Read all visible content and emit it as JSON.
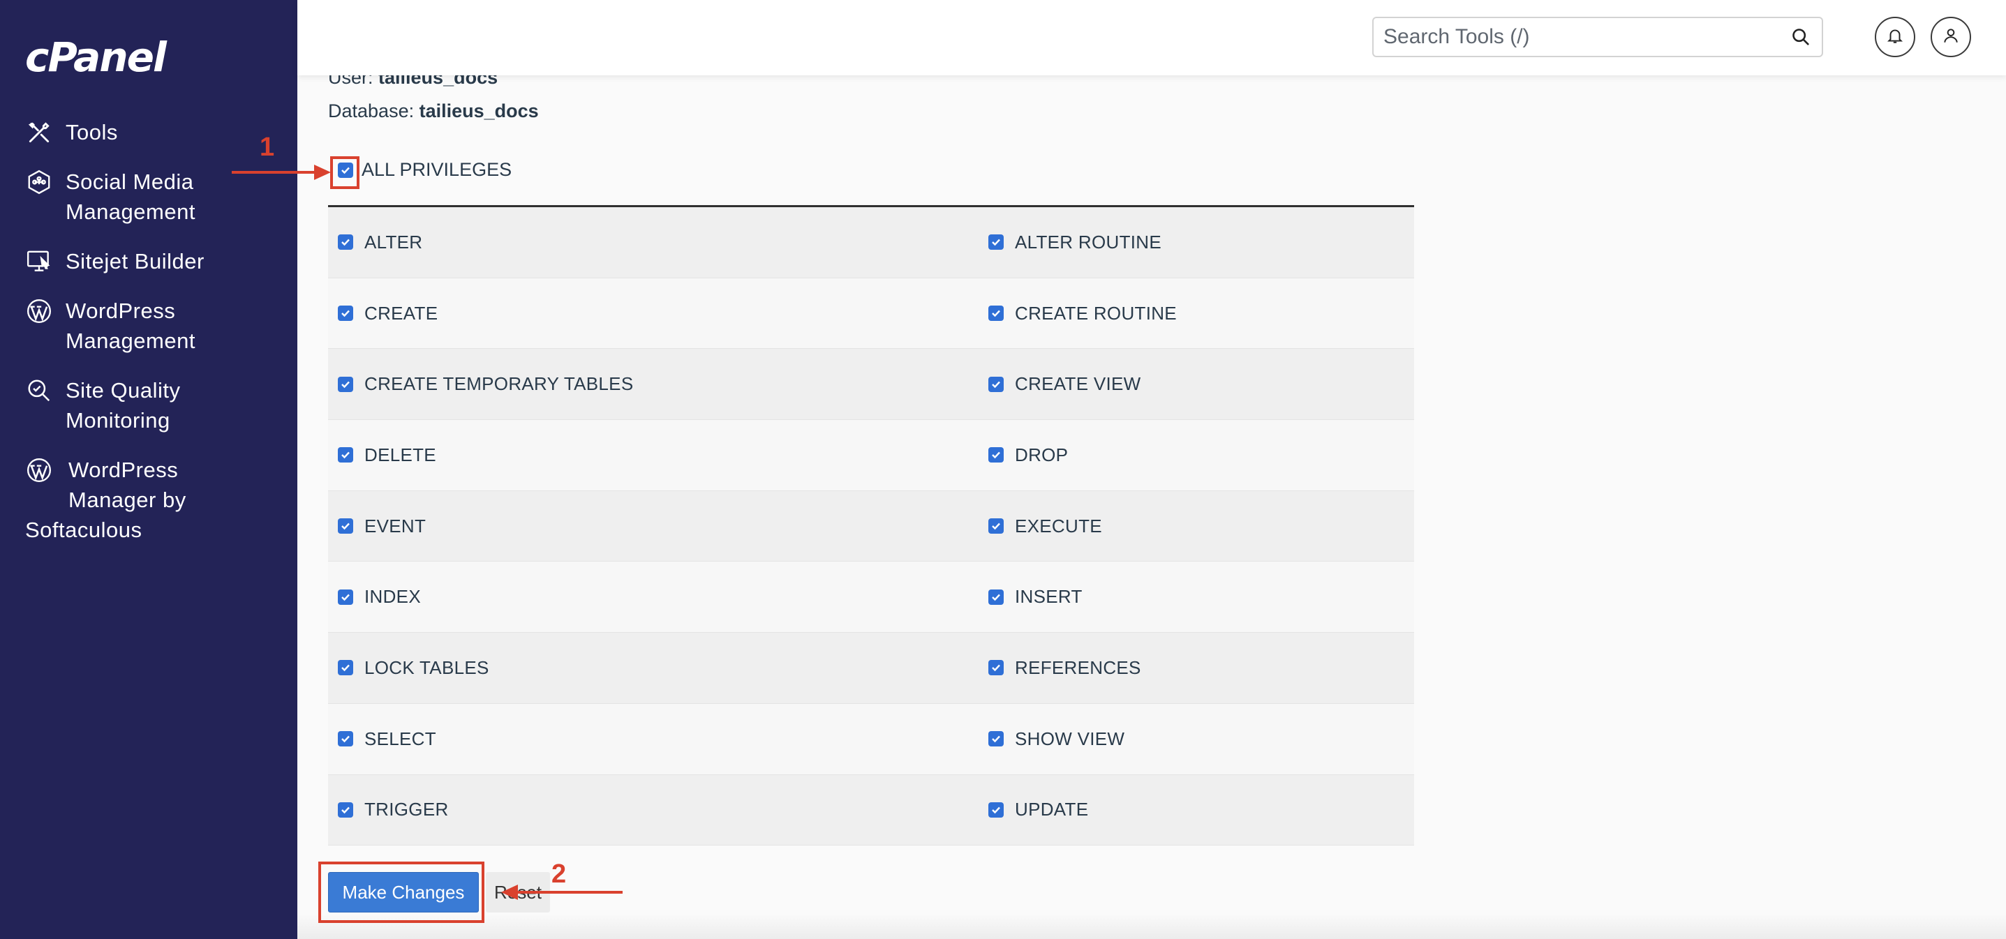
{
  "sidebar": {
    "logo": "cPanel",
    "items": [
      {
        "icon": "tools-icon",
        "lines": [
          "Tools"
        ]
      },
      {
        "icon": "social-media-icon",
        "lines": [
          "Social Media",
          "Management"
        ]
      },
      {
        "icon": "sitejet-icon",
        "lines": [
          "Sitejet Builder"
        ]
      },
      {
        "icon": "wordpress-icon",
        "lines": [
          "WordPress",
          "Management"
        ]
      },
      {
        "icon": "site-quality-icon",
        "lines": [
          "Site Quality",
          "Monitoring"
        ]
      },
      {
        "icon": "wordpress-icon",
        "lines": [
          "WordPress",
          "Manager by",
          "Softaculous"
        ]
      }
    ]
  },
  "header": {
    "search_placeholder": "Search Tools (/)"
  },
  "info": {
    "user_label": "User:",
    "user_value": "tailieus_docs",
    "db_label": "Database:",
    "db_value": "tailieus_docs"
  },
  "all_privileges": {
    "label": "ALL PRIVILEGES",
    "checked": true
  },
  "privileges": [
    [
      "ALTER",
      "ALTER ROUTINE"
    ],
    [
      "CREATE",
      "CREATE ROUTINE"
    ],
    [
      "CREATE TEMPORARY TABLES",
      "CREATE VIEW"
    ],
    [
      "DELETE",
      "DROP"
    ],
    [
      "EVENT",
      "EXECUTE"
    ],
    [
      "INDEX",
      "INSERT"
    ],
    [
      "LOCK TABLES",
      "REFERENCES"
    ],
    [
      "SELECT",
      "SHOW VIEW"
    ],
    [
      "TRIGGER",
      "UPDATE"
    ]
  ],
  "buttons": {
    "make_changes": "Make Changes",
    "reset": "Reset"
  },
  "annotations": {
    "step1": "1",
    "step2": "2",
    "color": "#d9412e"
  },
  "colors": {
    "sidebar": "#232357",
    "checkbox": "#2f6fd6",
    "primary_button": "#3a7bd5"
  }
}
